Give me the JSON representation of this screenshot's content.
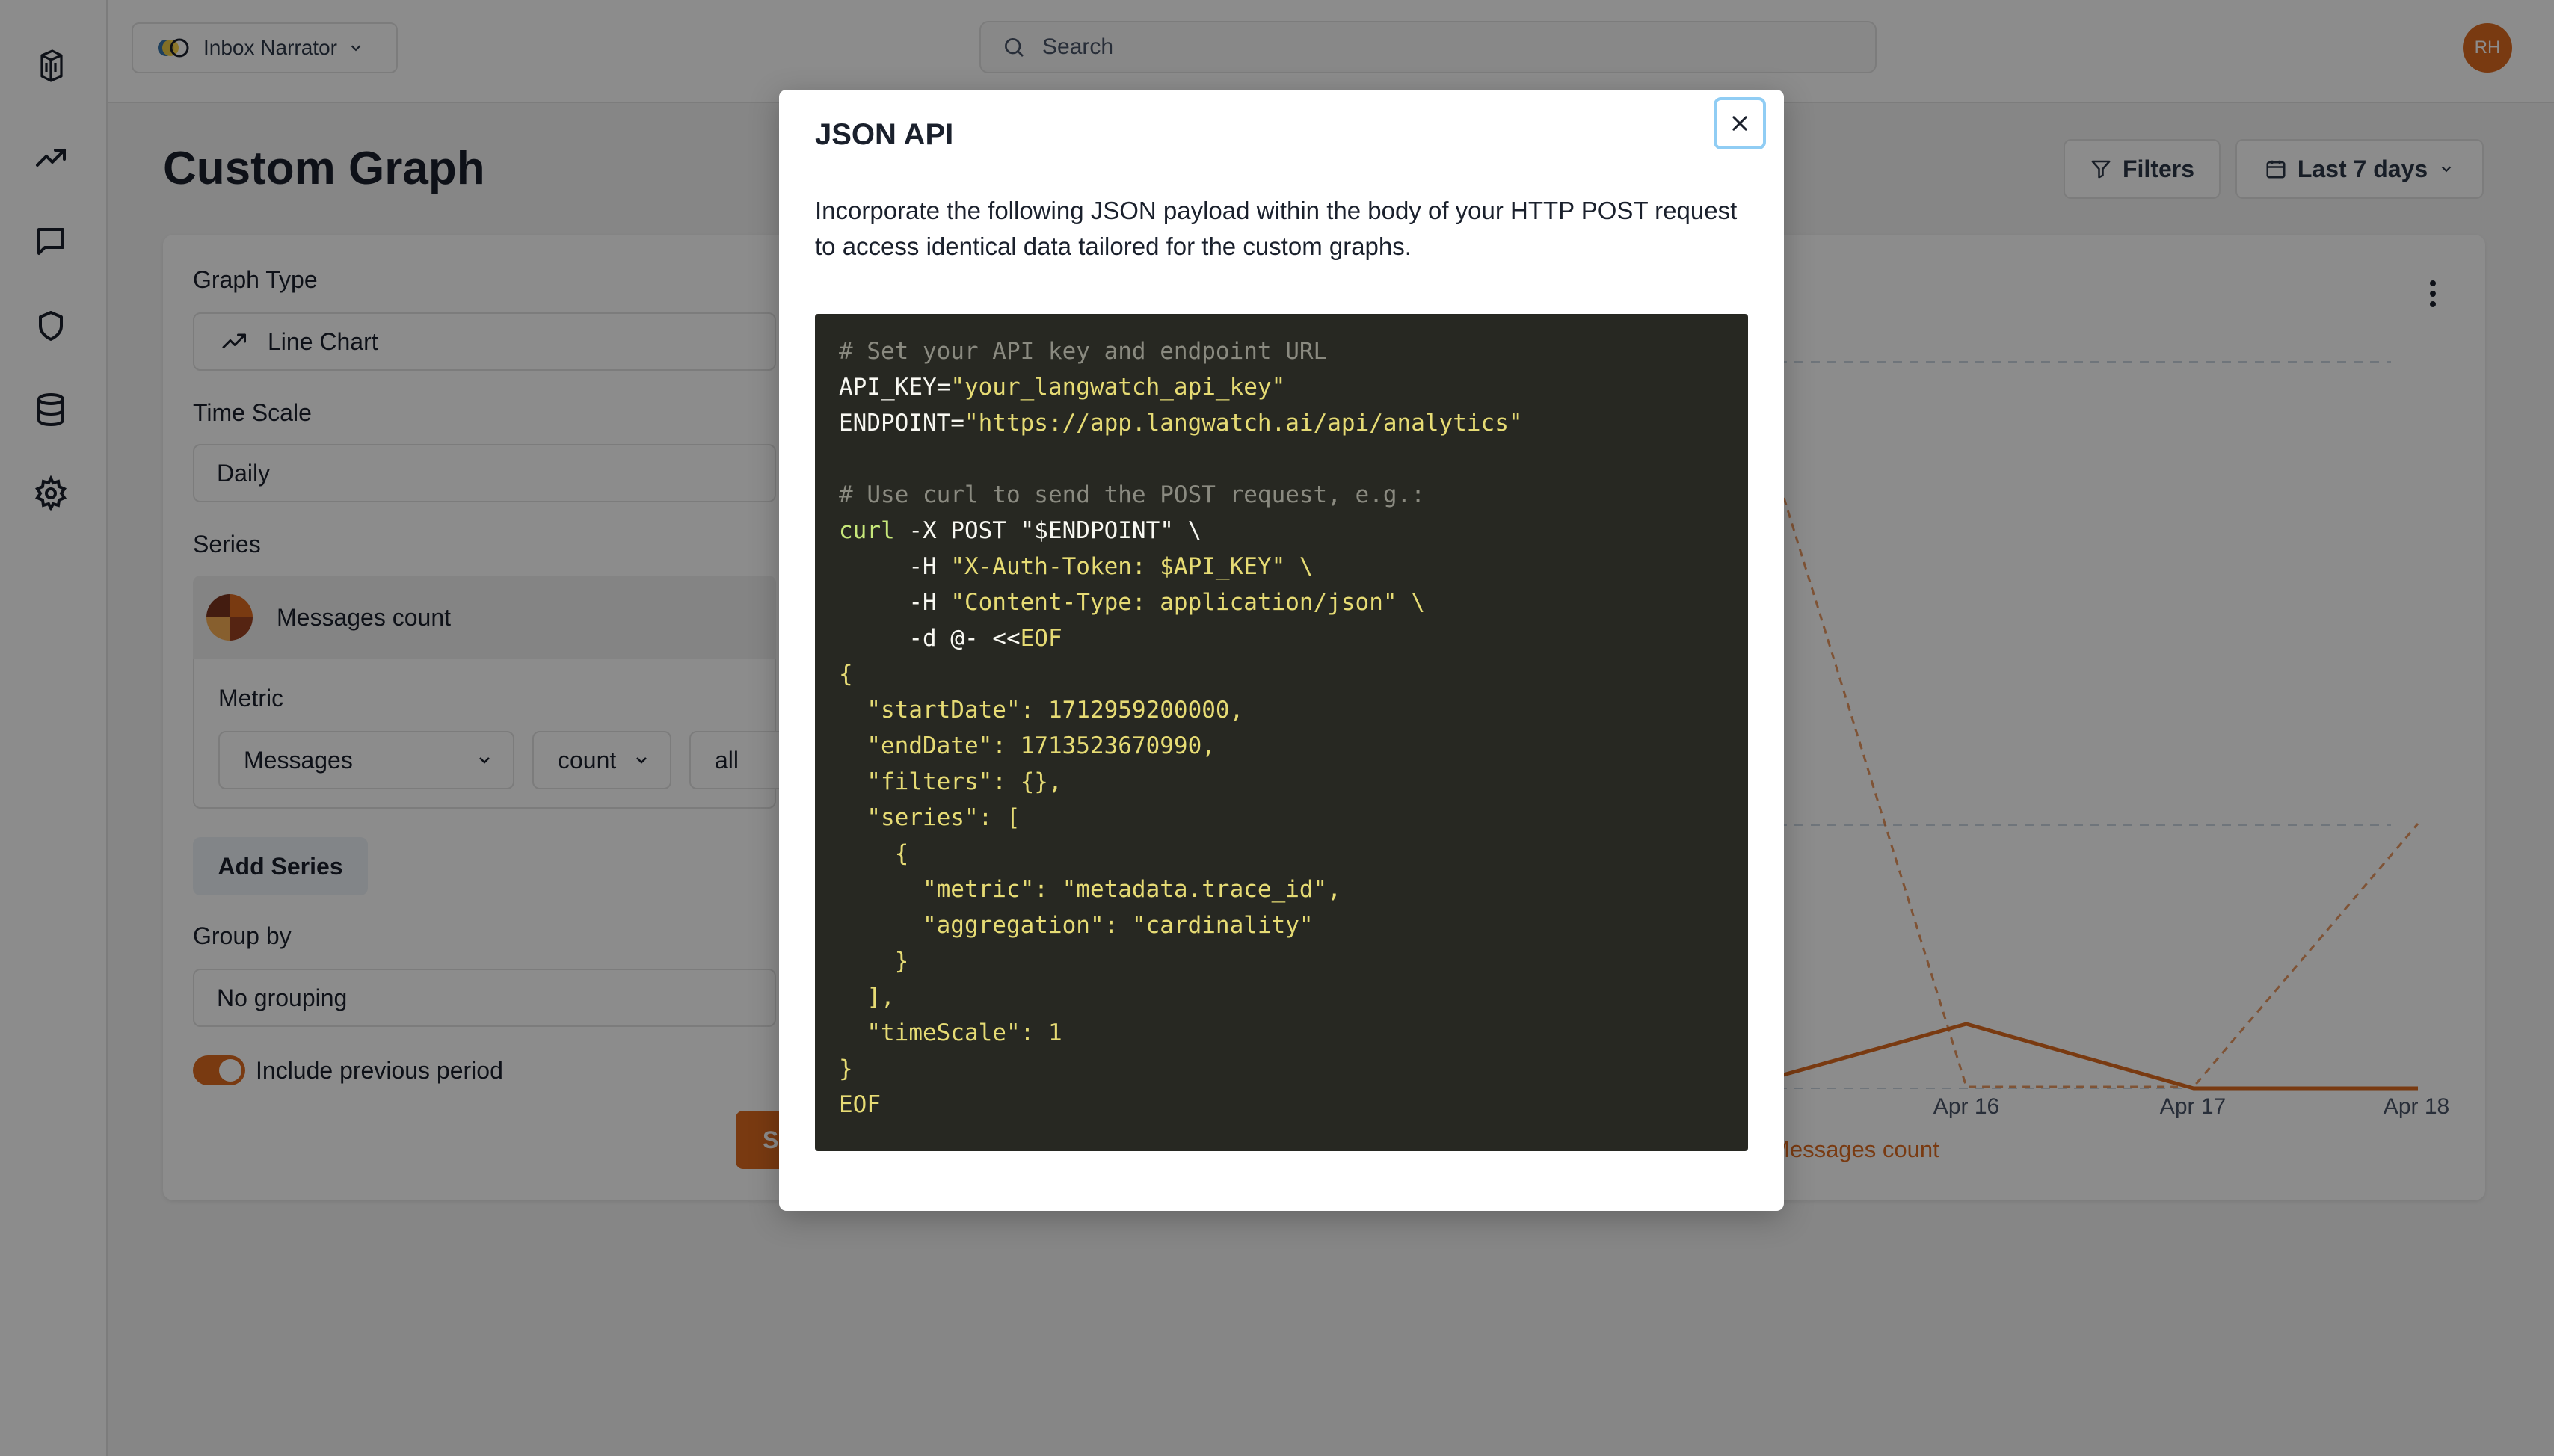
{
  "sidebar": {
    "icons": [
      "logo-icon",
      "analytics-icon",
      "messages-icon",
      "shield-icon",
      "database-icon",
      "settings-icon"
    ]
  },
  "header": {
    "project_name": "Inbox Narrator",
    "search_placeholder": "Search",
    "avatar_initials": "RH"
  },
  "page": {
    "title": "Custom Graph",
    "filters_label": "Filters",
    "date_range_label": "Last 7 days"
  },
  "form": {
    "graph_type_label": "Graph Type",
    "graph_type_value": "Line Chart",
    "time_scale_label": "Time Scale",
    "time_scale_value": "Daily",
    "series_label": "Series",
    "series_name": "Messages count",
    "metric_label": "Metric",
    "metric_value": "Messages",
    "aggregation_value": "count",
    "filter_value": "all",
    "add_series_label": "Add Series",
    "group_by_label": "Group by",
    "group_by_value": "No grouping",
    "include_previous_label": "Include previous period",
    "include_previous_enabled": true,
    "save_label": "Sa"
  },
  "chart_preview": {
    "x_ticks": [
      "Apr 16",
      "Apr 17",
      "Apr 18"
    ],
    "legend": "Messages count",
    "accent_color": "#dd6b20"
  },
  "modal": {
    "title": "JSON API",
    "description": "Incorporate the following JSON payload within the body of your HTTP POST request to access identical data tailored for the custom graphs.",
    "code": {
      "comment1": "# Set your API key and endpoint URL",
      "api_key_name": "API_KEY=",
      "api_key_value": "\"your_langwatch_api_key\"",
      "endpoint_name": "ENDPOINT=",
      "endpoint_value": "\"https://app.langwatch.ai/api/analytics\"",
      "comment2": "# Use curl to send the POST request, e.g.:",
      "curl_cmd": "curl",
      "curl_args": " -X POST \"$ENDPOINT\" \\",
      "h1_flag": "     -H ",
      "h1_value": "\"X-Auth-Token: $API_KEY\" \\",
      "h2_flag": "     -H ",
      "h2_value": "\"Content-Type: application/json\" \\",
      "d_flag": "     -d @- <<",
      "eof_open": "EOF",
      "brace_open": "{",
      "start_date": "  \"startDate\": 1712959200000,",
      "end_date": "  \"endDate\": 1713523670990,",
      "filters": "  \"filters\": {},",
      "series_open": "  \"series\": [",
      "obj_open": "    {",
      "metric": "      \"metric\": \"metadata.trace_id\",",
      "aggregation": "      \"aggregation\": \"cardinality\"",
      "obj_close": "    }",
      "series_close": "  ],",
      "time_scale": "  \"timeScale\": 1",
      "brace_close": "}",
      "eof_close": "EOF"
    }
  }
}
